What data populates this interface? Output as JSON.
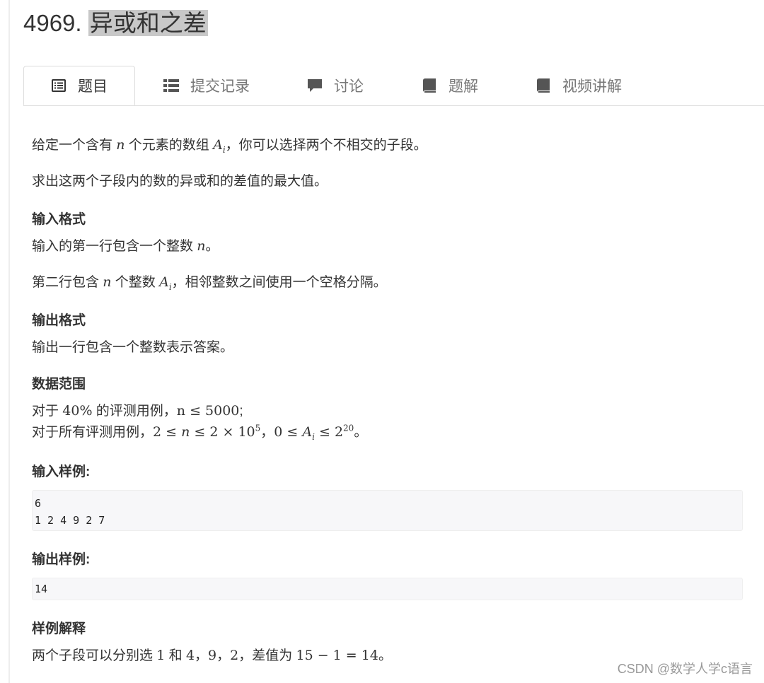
{
  "problem": {
    "number": "4969.",
    "name": "异或和之差"
  },
  "tabs": [
    {
      "label": "题目",
      "icon": "list-alt-icon",
      "active": true
    },
    {
      "label": "提交记录",
      "icon": "th-list-icon",
      "active": false
    },
    {
      "label": "讨论",
      "icon": "comment-icon",
      "active": false
    },
    {
      "label": "题解",
      "icon": "book-icon",
      "active": false
    },
    {
      "label": "视频讲解",
      "icon": "book-icon",
      "active": false
    }
  ],
  "statement": {
    "line1_a": "给定一个含有 ",
    "line1_var_n": "n",
    "line1_b": " 个元素的数组 ",
    "line1_var_A": "A",
    "line1_sub_i": "i",
    "line1_c": "，你可以选择两个不相交的子段。",
    "line2": "求出这两个子段内的数的异或和的差值的最大值。"
  },
  "input_format": {
    "heading": "输入格式",
    "line1_a": "输入的第一行包含一个整数 ",
    "line1_var_n": "n",
    "line1_b": "。",
    "line2_a": "第二行包含 ",
    "line2_var_n": "n",
    "line2_b": " 个整数 ",
    "line2_var_A": "A",
    "line2_sub_i": "i",
    "line2_c": "，相邻整数之间使用一个空格分隔。"
  },
  "output_format": {
    "heading": "输出格式",
    "line1": "输出一行包含一个整数表示答案。"
  },
  "data_range": {
    "heading": "数据范围",
    "line1_a": "对于 ",
    "line1_math_a": "40%",
    "line1_b": " 的评测用例，",
    "line1_math_b": "n ≤ 5000",
    "line1_c": ";",
    "line2_a": "对于所有评测用例，",
    "line2_math_a": "2 ≤ ",
    "line2_math_n": "n",
    "line2_math_b": " ≤ 2 × 10",
    "line2_sup_5": "5",
    "line2_b": "，",
    "line2_math_c": "0 ≤ ",
    "line2_math_A": "A",
    "line2_sub_i": "i",
    "line2_math_d": " ≤ 2",
    "line2_sup_20": "20",
    "line2_c": "。"
  },
  "sample_input": {
    "heading": "输入样例:",
    "lines": [
      "6",
      "1 2 4 9 2 7"
    ]
  },
  "sample_output": {
    "heading": "输出样例:",
    "lines": [
      "14"
    ]
  },
  "explanation": {
    "heading": "样例解释",
    "text_a": "两个子段可以分别选 ",
    "math_1": "1",
    "text_b": " 和 ",
    "math_2": "4，9，2",
    "text_c": "，差值为 ",
    "math_3": "15 − 1 = 14",
    "text_d": "。"
  },
  "watermark": "CSDN @数学人学c语言"
}
